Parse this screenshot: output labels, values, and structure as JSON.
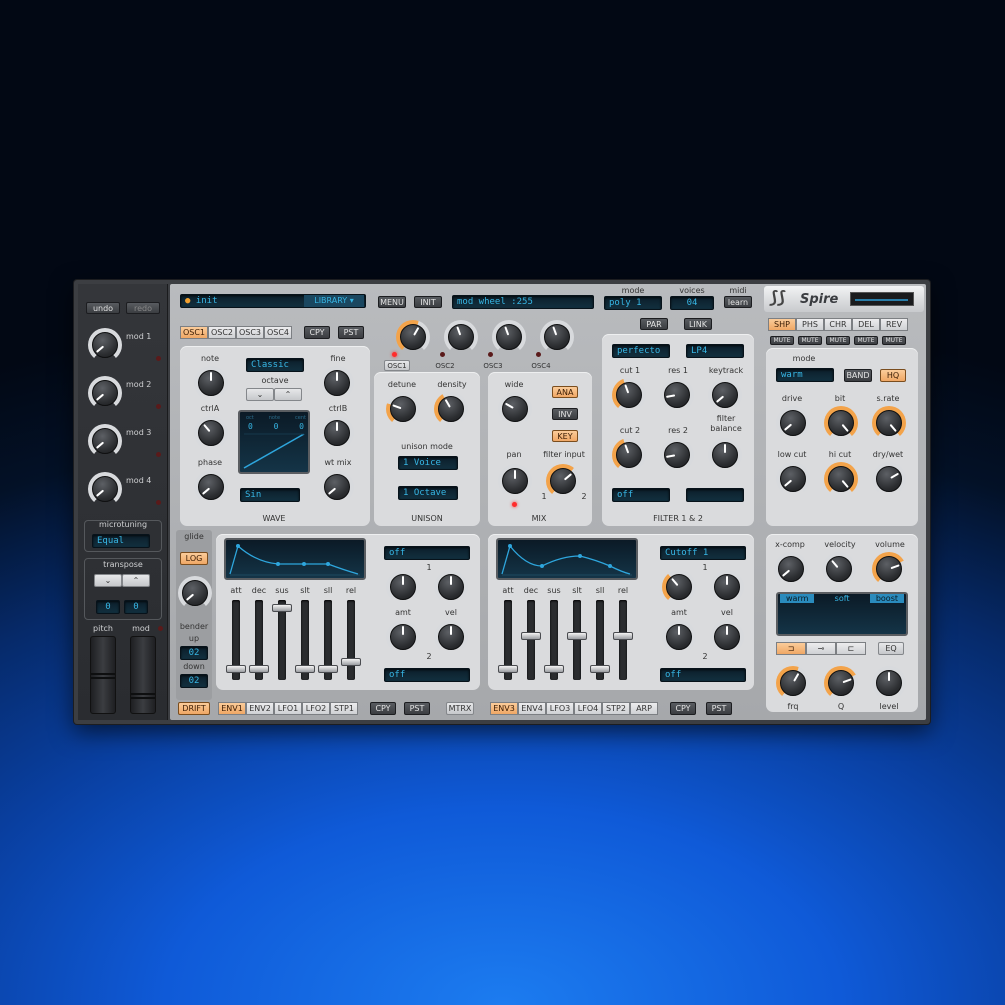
{
  "left": {
    "undo": "undo",
    "redo": "redo",
    "mods": [
      "mod 1",
      "mod 2",
      "mod 3",
      "mod 4"
    ],
    "microtuning_label": "microtuning",
    "microtuning_value": "Equal",
    "transpose_label": "transpose",
    "transpose_a": "0",
    "transpose_b": "0",
    "pitch": "pitch",
    "mod": "mod"
  },
  "top": {
    "preset": "init",
    "library": "LIBRARY",
    "menu": "MENU",
    "init": "INIT",
    "mod_display": "mod wheel :255",
    "mode_label": "mode",
    "mode_value": "poly 1",
    "voices_label": "voices",
    "voices_value": "04",
    "midi_label": "midi",
    "midi_value": "learn",
    "logo": "Spire"
  },
  "osc": {
    "tabs": [
      "OSC1",
      "OSC2",
      "OSC3",
      "OSC4"
    ],
    "cpy": "CPY",
    "pst": "PST",
    "sel": [
      "OSC1",
      "OSC2",
      "OSC3",
      "OSC4"
    ],
    "note": "note",
    "fine": "fine",
    "octave": "octave",
    "ctrlA": "ctrlA",
    "ctrlB": "ctrlB",
    "phase": "phase",
    "wtmix": "wt mix",
    "wave_type": "Classic",
    "wave_shape": "Sin",
    "wave_title": "WAVE",
    "display_heads": [
      "oct",
      "note",
      "cent"
    ],
    "display_vals": [
      "0",
      "0",
      "0"
    ]
  },
  "unison": {
    "detune": "detune",
    "density": "density",
    "mode_label": "unison mode",
    "voices": "1 Voice",
    "octave": "1 Octave",
    "title": "UNISON"
  },
  "mix": {
    "wide": "wide",
    "ana": "ANA",
    "inv": "INV",
    "key": "KEY",
    "pan": "pan",
    "filter_input": "filter input",
    "fi1": "1",
    "fi2": "2",
    "title": "MIX"
  },
  "filter": {
    "par": "PAR",
    "link": "LINK",
    "type1": "perfecto",
    "type2": "LP4",
    "cut1": "cut 1",
    "res1": "res 1",
    "keytrack": "keytrack",
    "cut2": "cut 2",
    "res2": "res 2",
    "balance": "filter balance",
    "f1": "off",
    "f2": "",
    "title": "FILTER 1 & 2"
  },
  "fx": {
    "tabs": [
      "SHP",
      "PHS",
      "CHR",
      "DEL",
      "REV"
    ],
    "mute": "MUTE",
    "mode_label": "mode",
    "mode_value": "warm",
    "band": "BAND",
    "hq": "HQ",
    "drive": "drive",
    "bit": "bit",
    "srate": "s.rate",
    "lowcut": "low cut",
    "hicut": "hi cut",
    "drywet": "dry/wet"
  },
  "glide": {
    "title": "glide",
    "log": "LOG",
    "bender": "bender",
    "up": "up",
    "up_val": "02",
    "down": "down",
    "down_val": "02",
    "drift": "DRIFT"
  },
  "env1": {
    "labels": [
      "att",
      "dec",
      "sus",
      "slt",
      "sll",
      "rel"
    ],
    "levels": [
      0.1,
      0.1,
      0.95,
      0.1,
      0.1,
      0.2
    ],
    "dest1": "off",
    "dest2": "off",
    "amt": "amt",
    "vel": "vel",
    "n1": "1",
    "n2": "2"
  },
  "env2": {
    "labels": [
      "att",
      "dec",
      "sus",
      "slt",
      "sll",
      "rel"
    ],
    "levels": [
      0.1,
      0.55,
      0.1,
      0.55,
      0.1,
      0.55
    ],
    "dest1": "Cutoff 1",
    "dest2": "off",
    "amt": "amt",
    "vel": "vel",
    "n1": "1",
    "n2": "2"
  },
  "bottom": {
    "tabs1": [
      "ENV1",
      "ENV2",
      "LFO1",
      "LFO2",
      "STP1"
    ],
    "cpy": "CPY",
    "pst": "PST",
    "mtrx": "MTRX",
    "tabs2": [
      "ENV3",
      "ENV4",
      "LFO3",
      "LFO4",
      "STP2",
      "ARP"
    ]
  },
  "master": {
    "xcomp": "x-comp",
    "velocity": "velocity",
    "volume": "volume",
    "eq_modes": [
      "warm",
      "soft",
      "boost"
    ],
    "eq": "EQ",
    "frq": "frq",
    "q": "Q",
    "level": "level"
  },
  "colors": {
    "accent": "#f0a765",
    "lcd": "#37b7e6"
  }
}
